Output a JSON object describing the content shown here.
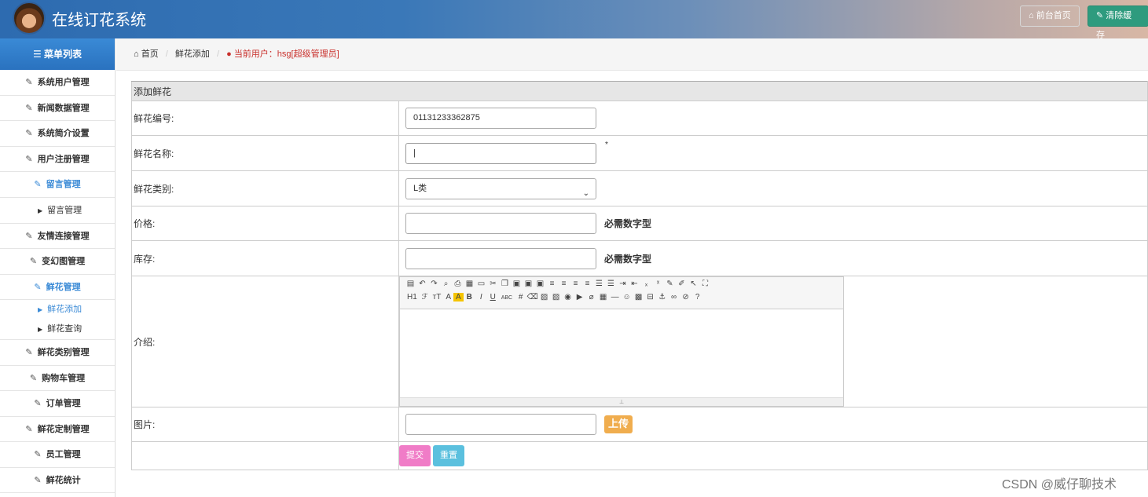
{
  "header": {
    "title": "在线订花系统",
    "home_button": "前台首页",
    "clear_cache_button": "清除缓存"
  },
  "sidebar": {
    "title": "菜单列表",
    "items": [
      {
        "label": "系统用户管理"
      },
      {
        "label": "新闻数据管理"
      },
      {
        "label": "系统简介设置"
      },
      {
        "label": "用户注册管理"
      },
      {
        "label": "留言管理"
      },
      {
        "label": "留言管理"
      },
      {
        "label": "友情连接管理"
      },
      {
        "label": "变幻图管理"
      },
      {
        "label": "鲜花管理"
      },
      {
        "label": "鲜花添加"
      },
      {
        "label": "鲜花查询"
      },
      {
        "label": "鲜花类别管理"
      },
      {
        "label": "购物车管理"
      },
      {
        "label": "订单管理"
      },
      {
        "label": "鲜花定制管理"
      },
      {
        "label": "员工管理"
      },
      {
        "label": "鲜花统计"
      }
    ]
  },
  "breadcrumb": {
    "home": "首页",
    "current": "鲜花添加",
    "user": "当前用户：hsg[超级管理员]"
  },
  "form": {
    "caption": "添加鲜花",
    "code_label": "鲜花编号:",
    "code_value": "01131233362875",
    "name_label": "鲜花名称:",
    "name_value": "|",
    "required_mark": "*",
    "category_label": "鲜花类别:",
    "category_value": "L类",
    "price_label": "价格:",
    "price_hint": "必需数字型",
    "stock_label": "库存:",
    "stock_hint": "必需数字型",
    "intro_label": "介绍:",
    "image_label": "图片:",
    "upload_button": "上传",
    "submit_button": "提交",
    "reset_button": "重置"
  },
  "editor": {
    "row2": [
      "H1",
      "ℱ",
      "тT",
      "A",
      "A",
      "B",
      "I",
      "U",
      "ABC"
    ]
  },
  "watermark": "CSDN @威仔聊技术",
  "colors": {
    "menu_header": "#2a72bf",
    "active_menu": "#3a8ad6",
    "user_text": "#c9302c",
    "upload": "#f0ad4e",
    "submit": "#f07cc7",
    "reset": "#5bc0de",
    "clear_cache": "#2e9b7e"
  }
}
